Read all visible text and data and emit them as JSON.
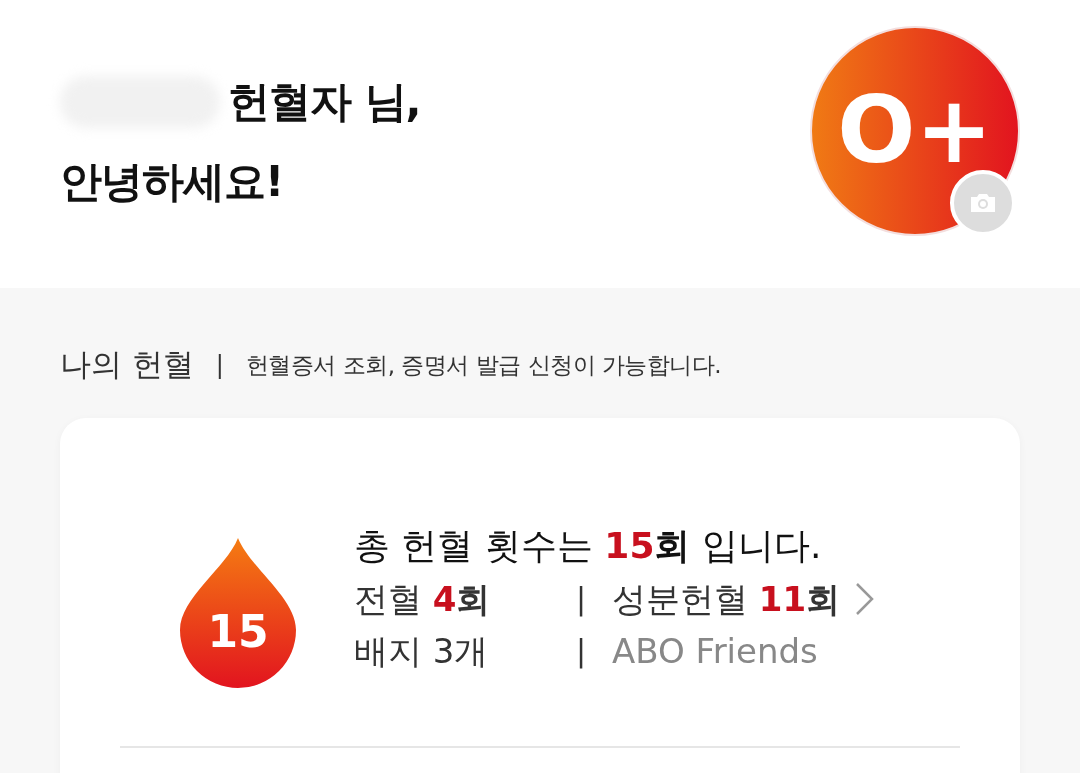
{
  "greeting": {
    "name_hidden": true,
    "line1": "헌혈자 님,",
    "line2": "안녕하세요!"
  },
  "blood_type": "O+",
  "section": {
    "title": "나의 헌혈",
    "separator": "|",
    "subtitle": "헌혈증서 조회, 증명서 발급 신청이 가능합니다."
  },
  "summary": {
    "drop_count": "15",
    "prefix": "총 헌혈 횟수는 ",
    "count": "15",
    "unit": "회",
    "suffix": " 입니다.",
    "stats": [
      {
        "label": "전혈",
        "count": "4",
        "unit": "회"
      },
      {
        "label": "성분헌혈",
        "count": "11",
        "unit": "회"
      }
    ],
    "badges": "배지 3개",
    "friends": "ABO Friends",
    "separators": [
      "|",
      "|"
    ]
  }
}
